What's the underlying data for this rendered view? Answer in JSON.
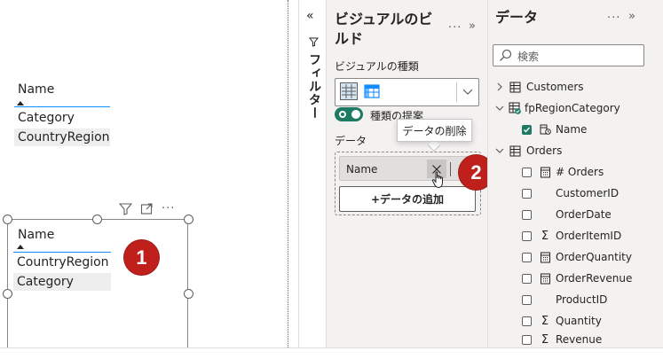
{
  "canvas": {
    "table1": {
      "header": "Name",
      "rows": [
        "Category",
        "CountryRegion"
      ]
    },
    "table2": {
      "header": "Name",
      "rows": [
        "CountryRegion",
        "Category"
      ]
    },
    "badges": [
      "1",
      "2"
    ]
  },
  "filter_pane": {
    "collapse_glyph": "«",
    "label": "フィルター"
  },
  "build_pane": {
    "title": "ビジュアルのビルド",
    "more_glyph": "···",
    "collapse_glyph": "»",
    "vis_type_label": "ビジュアルの種類",
    "suggest_label": "種類の提案",
    "data_label": "データ",
    "field_chip": "Name",
    "tooltip": "データの削除",
    "add_data": "+データの追加"
  },
  "data_pane": {
    "title": "データ",
    "more_glyph": "···",
    "collapse_glyph": "»",
    "search_placeholder": "検索",
    "tree": [
      {
        "label": "Customers"
      },
      {
        "label": "fpRegionCategory"
      },
      {
        "label": "Name"
      },
      {
        "label": "Orders"
      },
      {
        "label": "# Orders"
      },
      {
        "label": "CustomerID"
      },
      {
        "label": "OrderDate"
      },
      {
        "label": "OrderItemID"
      },
      {
        "label": "OrderQuantity"
      },
      {
        "label": "OrderRevenue"
      },
      {
        "label": "ProductID"
      },
      {
        "label": "Quantity"
      },
      {
        "label": "Revenue"
      }
    ]
  },
  "colors": {
    "accent_blue": "#118dff",
    "toggle_green": "#1f7a64",
    "badge_red": "#c0201c",
    "pane_bg": "#f3f2f1"
  }
}
